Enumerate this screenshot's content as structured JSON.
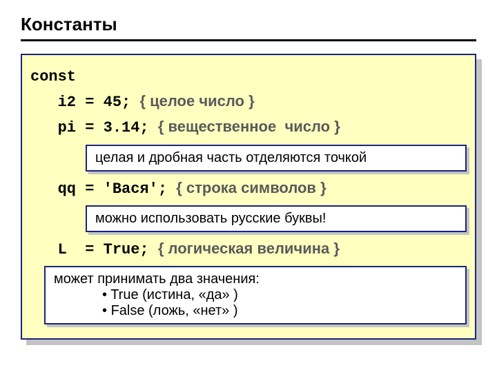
{
  "title": "Константы",
  "code": {
    "keyword": "const",
    "line1_pre": "   i2 = 45; ",
    "line1_comment": "{ целое число }",
    "line2_pre": "   pi = 3.14; ",
    "line2_comment": "{ вещественное  число }",
    "note1": "целая и дробная часть отделяются точкой",
    "line3_pre": "   qq = 'Вася'; ",
    "line3_comment": "{ строка символов }",
    "note2": "можно использовать русские буквы!",
    "line4_pre": "   L  = True; ",
    "line4_comment": "{ логическая величина }",
    "note3_intro": "может принимать два значения:",
    "note3_b1": "True (истина, «да» )",
    "note3_b2": "False (ложь, «нет» )"
  }
}
